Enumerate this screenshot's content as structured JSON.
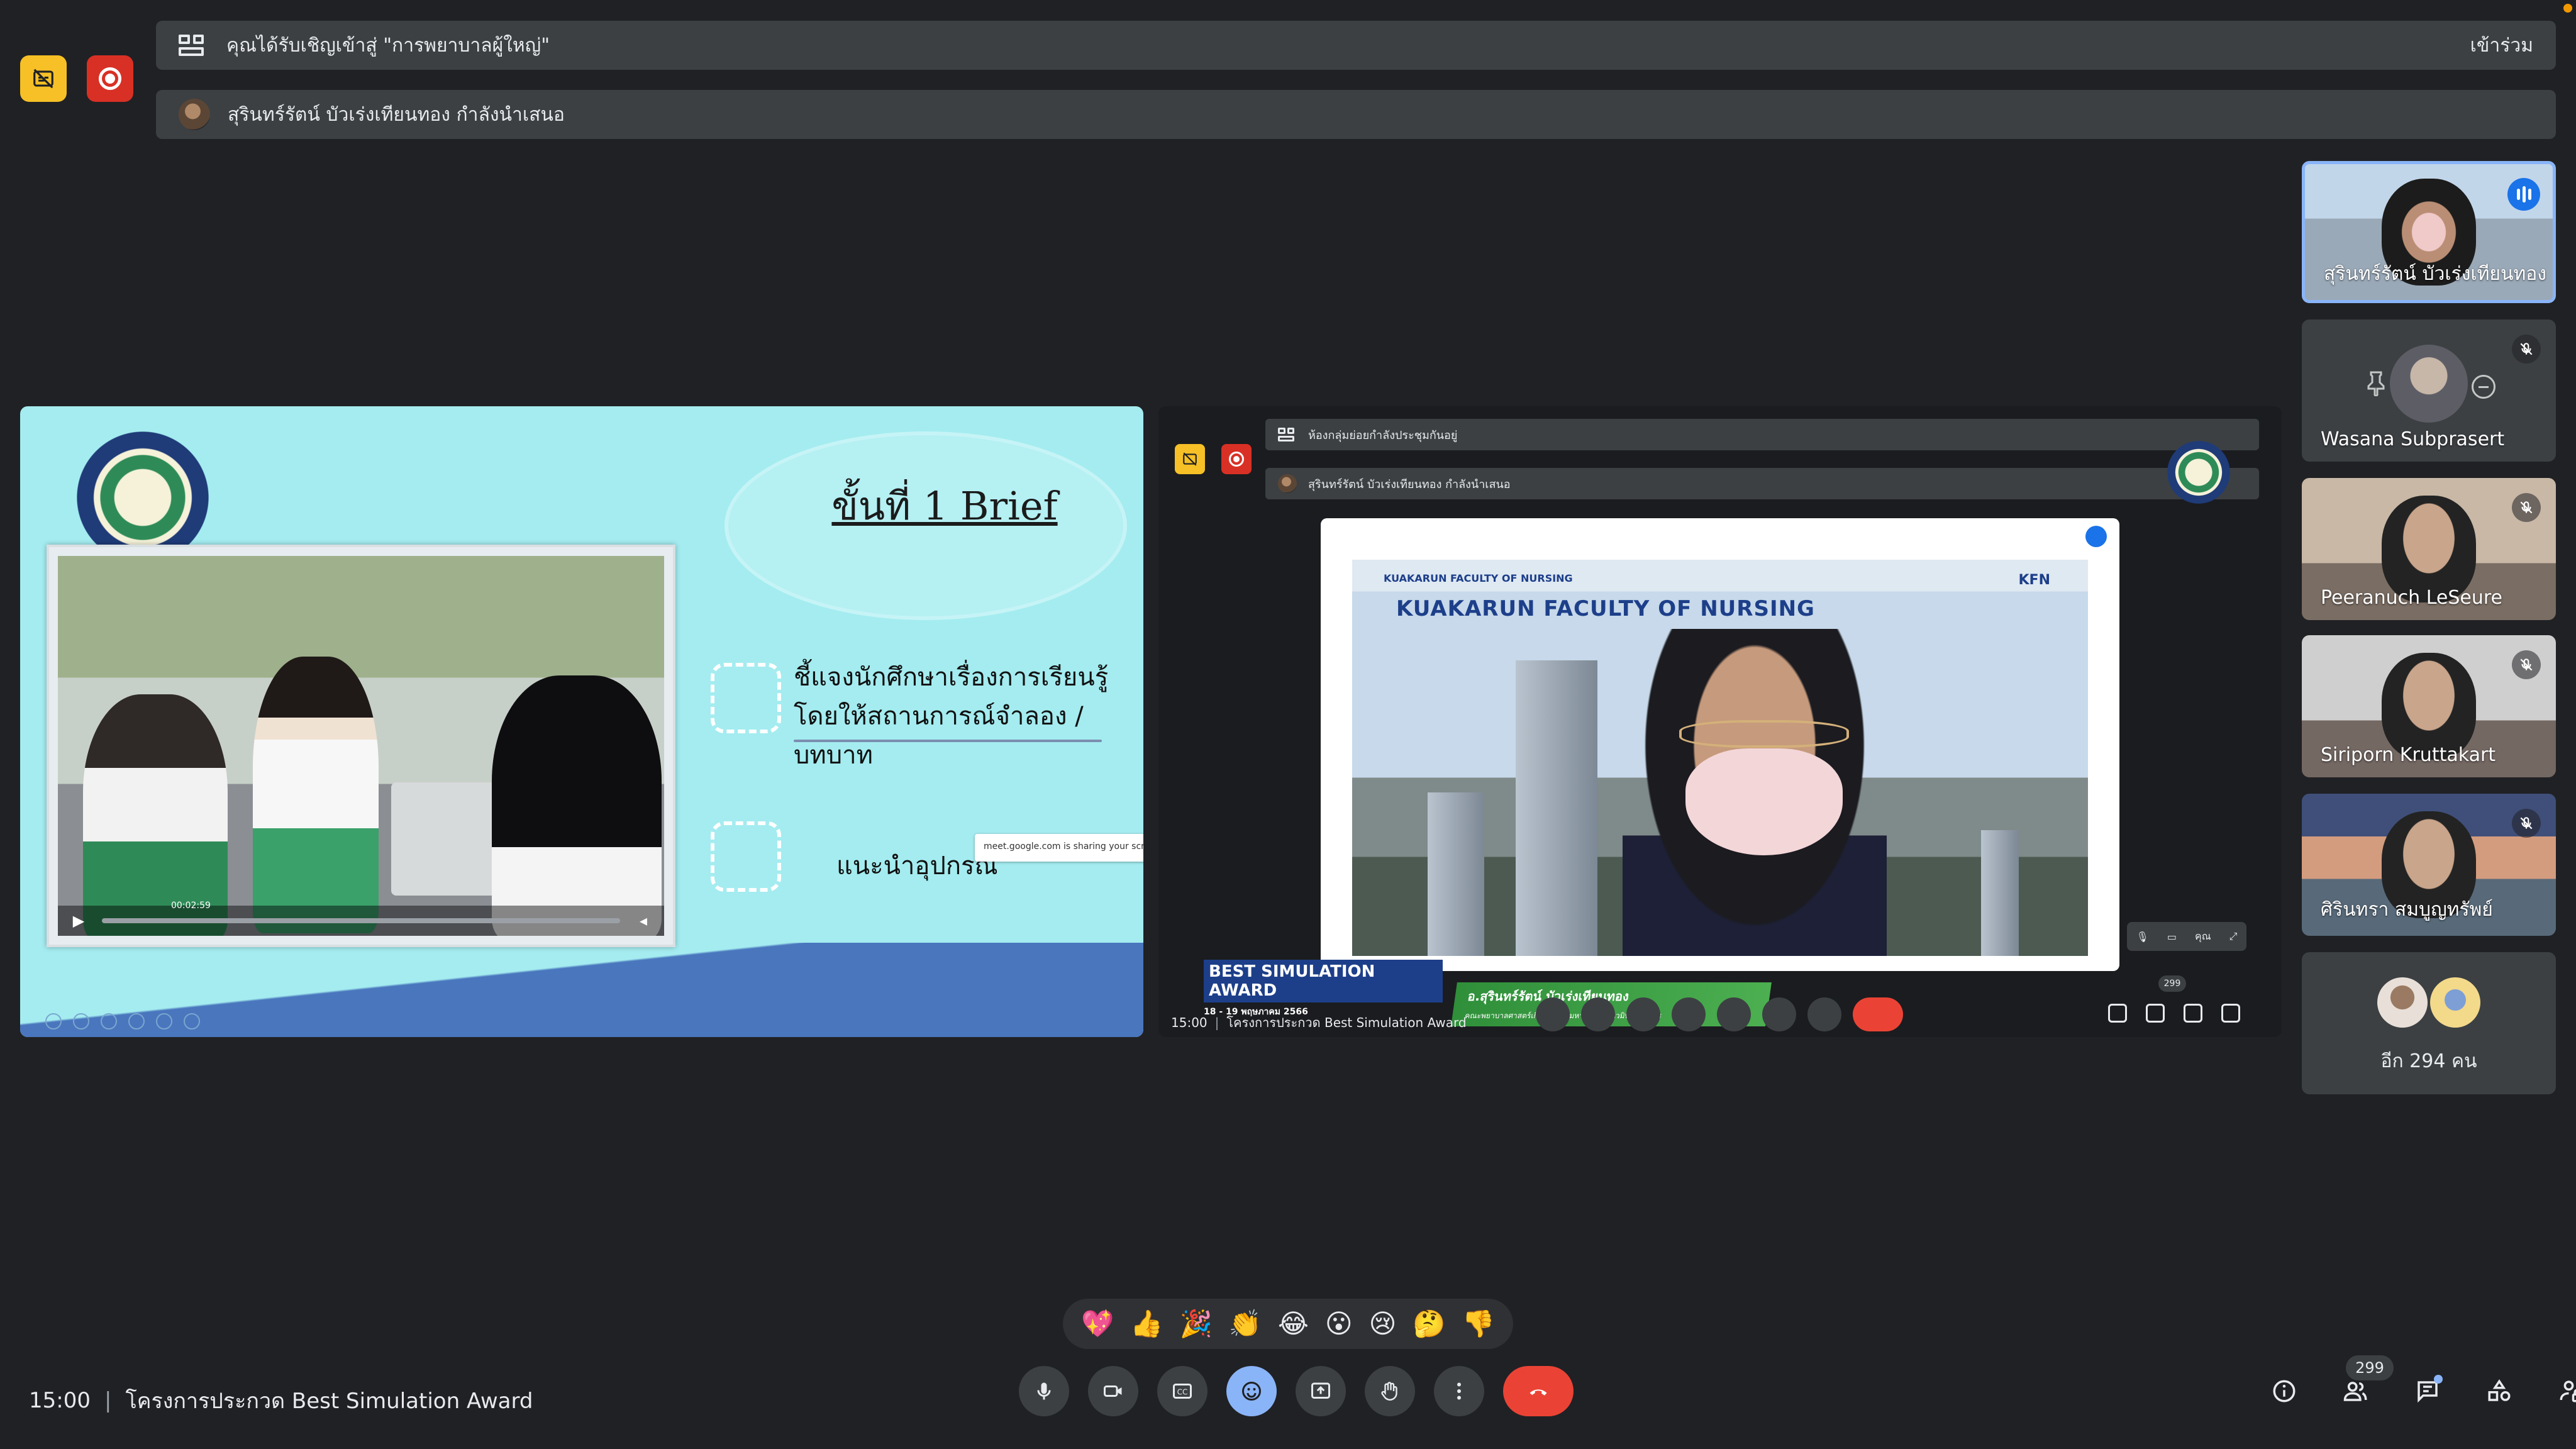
{
  "notifications": {
    "breakout_invite": "คุณได้รับเชิญเข้าสู่ \"การพยาบาลผู้ใหญ่\"",
    "join_label": "เข้าร่วม",
    "presenting": "สุรินทร์รัตน์ บัวเร่งเทียนทอง กำลังนำเสนอ"
  },
  "slide": {
    "title": "ขั้นที่ 1 Brief",
    "bullet1": "ชี้แจงนักศึกษาเรื่องการเรียนรู้โดยให้สถานการณ์จำลอง /บทบาท",
    "bullet2": "แนะนำอุปกรณ์",
    "video_time": "00:02:59",
    "toast": "meet.google.com is sharing your screen."
  },
  "shared_screen": {
    "breakout_notice": "ห้องกลุ่มย่อยกำลังประชุมกันอยู่",
    "presenting": "สุรินทร์รัตน์ บัวเร่งเทียนทอง กำลังนำเสนอ",
    "faculty_small": "KUAKARUN FACULTY OF NURSING",
    "faculty_big": "KUAKARUN FACULTY OF NURSING",
    "kfn": "KFN",
    "award_title": "BEST SIMULATION AWARD",
    "award_date": "18 - 19 พฤษภาคม 2566",
    "speaker_name": "อ.สุรินทร์รัตน์ บัวเร่งเทียนทอง",
    "speaker_sub": "คณะพยาบาลศาสตร์เกื้อการุณย์ มหาวิทยาลัยนวมินทราธิราช",
    "bottom_time": "15:00",
    "bottom_title": "โครงการประกวด Best Simulation Award",
    "self_label": "คุณ",
    "participant_count": "299"
  },
  "participants": [
    {
      "name": "สุรินทร์รัตน์ บัวเร่งเทียนทอง",
      "speaking": true
    },
    {
      "name": "Wasana Subprasert",
      "muted": true
    },
    {
      "name": "Peeranuch LeSeure",
      "muted": true
    },
    {
      "name": "Siriporn Kruttakart",
      "muted": true
    },
    {
      "name": "ศิรินทรา สมบูญทรัพย์",
      "muted": true
    }
  ],
  "others": {
    "label": "อีก 294 คน"
  },
  "reactions": [
    "💖",
    "👍",
    "🎉",
    "👏",
    "😂",
    "😮",
    "😢",
    "🤔",
    "👎"
  ],
  "bottom_bar": {
    "time": "15:00",
    "meeting_title": "โครงการประกวด Best Simulation Award",
    "participant_count": "299"
  },
  "colors": {
    "background": "#202124",
    "surface": "#3c4043",
    "accent": "#8ab4f8",
    "end_call": "#ea4335",
    "record": "#d93025",
    "captions_off": "#f6c026"
  }
}
